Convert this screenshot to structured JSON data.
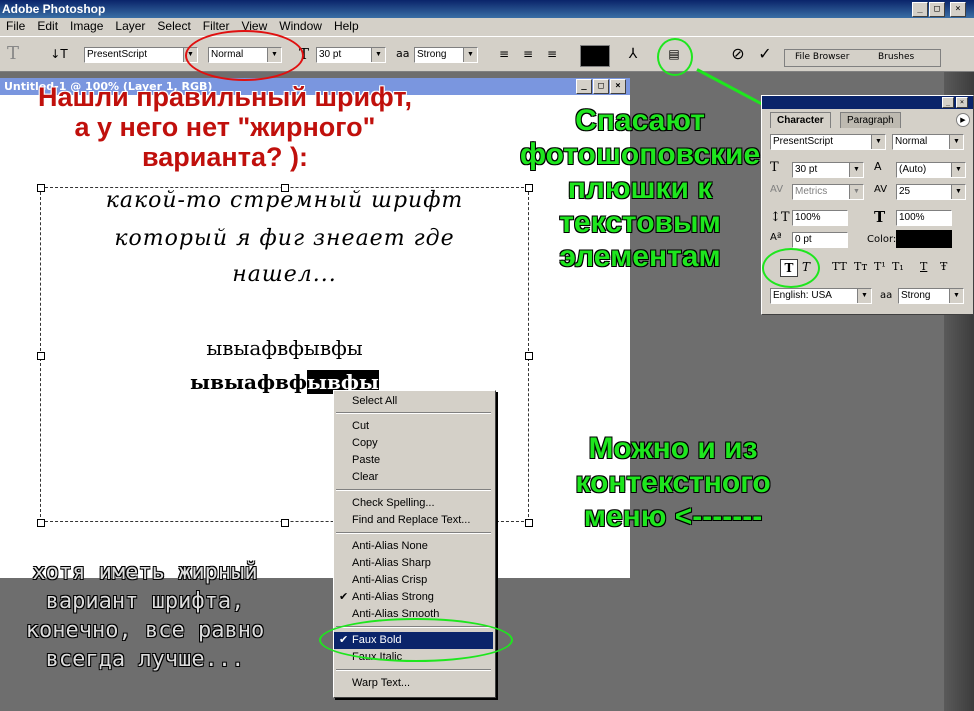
{
  "app": {
    "title": "Adobe Photoshop"
  },
  "menu": [
    "File",
    "Edit",
    "Image",
    "Layer",
    "Select",
    "Filter",
    "View",
    "Window",
    "Help"
  ],
  "options": {
    "tool_icon": "T",
    "font_family": "PresentScript",
    "font_style": "Normal",
    "font_size": "30 pt",
    "antialias_label": "aa",
    "antialias": "Strong"
  },
  "palettes": {
    "file_browser": "File Browser",
    "brushes": "Brushes"
  },
  "document": {
    "title": "Untitled-1 @ 100% (Layer 1, RGB)",
    "line1": "какой-то стремный шрифт",
    "line2": "который я фиг знеает где",
    "line3": "нашел...",
    "line4": "ывыафвфывфы",
    "line5_normal": "ывыафвф",
    "line5_selected": "ывфы"
  },
  "annotations": {
    "red_note": "Нашли правильный шрифт, а у него нет \"жирного\" варианта? ):",
    "green_note1": "Спасают фотошоповские плюшки к текстовым элементам",
    "green_note2": "Можно и из контекстного меню <-------",
    "grey_note": "хотя иметь жирный вариант шрифта, конечно, все равно всегда лучше..."
  },
  "context_menu": {
    "items": [
      {
        "label": "Select All"
      },
      {
        "label": "Cut"
      },
      {
        "label": "Copy"
      },
      {
        "label": "Paste"
      },
      {
        "label": "Clear"
      },
      {
        "label": "Check Spelling..."
      },
      {
        "label": "Find and Replace Text..."
      },
      {
        "label": "Anti-Alias None"
      },
      {
        "label": "Anti-Alias Sharp"
      },
      {
        "label": "Anti-Alias Crisp"
      },
      {
        "label": "Anti-Alias Strong",
        "checked": true
      },
      {
        "label": "Anti-Alias Smooth"
      },
      {
        "label": "Faux Bold",
        "checked": true,
        "selected": true
      },
      {
        "label": "Faux Italic"
      },
      {
        "label": "Warp Text..."
      }
    ]
  },
  "character_panel": {
    "tab_character": "Character",
    "tab_paragraph": "Paragraph",
    "font_family": "PresentScript",
    "font_style": "Normal",
    "size": "30 pt",
    "leading": "(Auto)",
    "kerning": "Metrics",
    "tracking": "25",
    "vscale": "100%",
    "hscale": "100%",
    "baseline": "0 pt",
    "color_label": "Color:",
    "language": "English: USA",
    "antialias": "Strong",
    "style_buttons": [
      "T",
      "T",
      "TT",
      "Tт",
      "T¹",
      "T₁",
      "T",
      "Ŧ"
    ]
  },
  "colors": {
    "annotation_green": "#1ee61e",
    "annotation_red": "#c0100c",
    "highlight": "#0a246a"
  }
}
